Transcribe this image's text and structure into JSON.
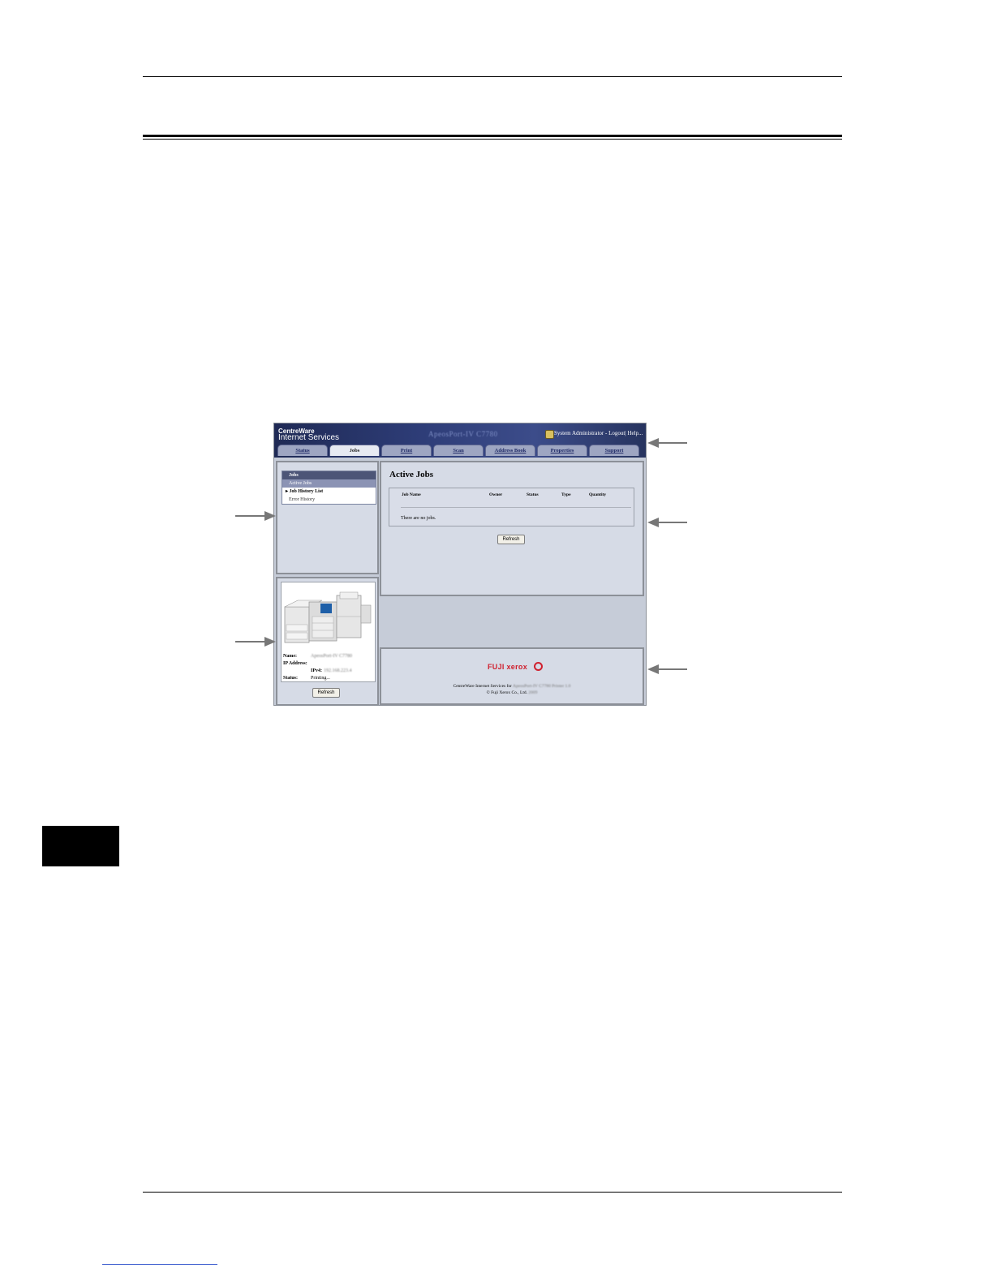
{
  "header": {
    "brand_line1": "CentreWare",
    "brand_line2": "Internet Services",
    "model": "ApeosPort-IV C7780",
    "admin": "System Administrator - Logout| Help..."
  },
  "tabs": [
    {
      "label": "Status"
    },
    {
      "label": "Jobs"
    },
    {
      "label": "Print"
    },
    {
      "label": "Scan"
    },
    {
      "label": "Address Book"
    },
    {
      "label": "Properties"
    },
    {
      "label": "Support"
    }
  ],
  "menu": {
    "header": "Jobs",
    "items": [
      "Active Jobs",
      "Job History List",
      "Error History"
    ]
  },
  "device": {
    "name_label": "Name:",
    "name_value": "ApeosPort-IV C7780",
    "ip_label": "IP Address:",
    "ipv4_label": "IPv4:",
    "ipv4_value": "192.168.223.4",
    "status_label": "Status:",
    "status_value": "Printing...",
    "refresh": "Refresh"
  },
  "content": {
    "title": "Active Jobs",
    "columns": [
      "Job Name",
      "Owner",
      "Status",
      "Type",
      "Quantity"
    ],
    "empty_message": "There are no jobs.",
    "refresh": "Refresh"
  },
  "footer": {
    "logo": "FUJI xerox",
    "line1_prefix": "CentreWare Internet Services for ",
    "line1_model": "ApeosPort-IV C7780 Printer 1.0",
    "line2_prefix": "© Fuji Xerox Co., Ltd. ",
    "line2_year": "2009"
  },
  "colors": {
    "header_bg": "#2e3d78",
    "panel_bg": "#d6dbe6",
    "logo_red": "#d0202e"
  }
}
